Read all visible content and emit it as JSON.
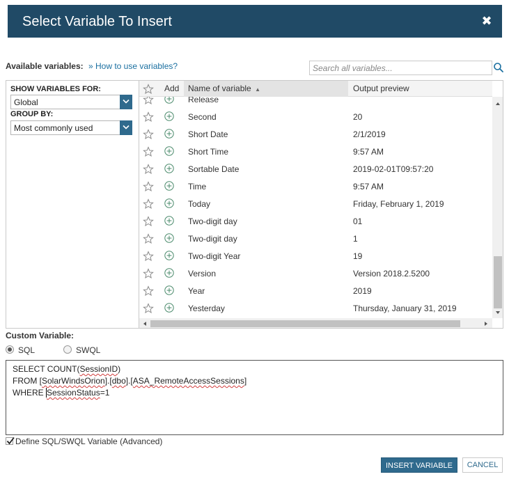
{
  "dialog": {
    "title": "Select Variable To Insert",
    "close_glyph": "✖"
  },
  "available": {
    "label": "Available variables:",
    "separator": "»",
    "help_link": "How to use variables?",
    "search_placeholder": "Search all variables..."
  },
  "filters": {
    "show_for_label": "SHOW VARIABLES FOR:",
    "show_for_value": "Global",
    "group_by_label": "GROUP BY:",
    "group_by_value": "Most commonly used"
  },
  "table": {
    "headers": {
      "add": "Add",
      "name": "Name of variable",
      "name_sort": "▲",
      "output": "Output preview"
    },
    "rows": [
      {
        "name": "Release",
        "output": ""
      },
      {
        "name": "Second",
        "output": "20"
      },
      {
        "name": "Short Date",
        "output": "2/1/2019"
      },
      {
        "name": "Short Time",
        "output": "9:57 AM"
      },
      {
        "name": "Sortable Date",
        "output": "2019-02-01T09:57:20"
      },
      {
        "name": "Time",
        "output": "9:57 AM"
      },
      {
        "name": "Today",
        "output": "Friday, February 1, 2019"
      },
      {
        "name": "Two-digit day",
        "output": "01"
      },
      {
        "name": "Two-digit day",
        "output": "1"
      },
      {
        "name": "Two-digit Year",
        "output": "19"
      },
      {
        "name": "Version",
        "output": "Version 2018.2.5200"
      },
      {
        "name": "Year",
        "output": "2019"
      },
      {
        "name": "Yesterday",
        "output": "Thursday, January 31, 2019"
      }
    ]
  },
  "custom": {
    "label": "Custom Variable:",
    "radio_sql": "SQL",
    "radio_swql": "SWQL",
    "selected": "SQL",
    "sql_lines": [
      [
        "SELECT COUNT(",
        "SessionID",
        ")"
      ],
      [
        "FROM [",
        "SolarWindsOrion",
        "].[",
        "dbo",
        "].[",
        "ASA_RemoteAccessSessions",
        "]"
      ],
      [
        "WHERE ",
        "SessionStatus",
        "=1"
      ]
    ],
    "advanced_label": "Define SQL/SWQL Variable (Advanced)",
    "advanced_checked": true
  },
  "buttons": {
    "insert": "INSERT VARIABLE",
    "cancel": "CANCEL"
  },
  "colors": {
    "title_bg": "#204a66",
    "accent": "#2f6a8d",
    "link": "#1a6fa0"
  }
}
